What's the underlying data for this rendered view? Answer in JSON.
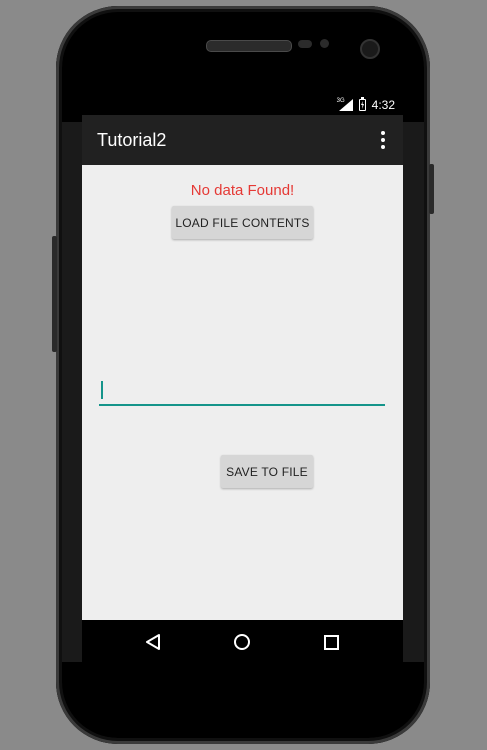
{
  "status_bar": {
    "network": "3G",
    "time": "4:32"
  },
  "app_bar": {
    "title": "Tutorial2",
    "menu_icon": "overflow-menu-icon"
  },
  "content": {
    "message": "No data Found!",
    "message_color": "#e53935",
    "load_button_label": "LOAD FILE CONTENTS",
    "input_value": "",
    "save_button_label": "SAVE TO FILE",
    "accent_color": "#14948a"
  },
  "nav_bar": {
    "back_icon": "back-icon",
    "home_icon": "home-icon",
    "recents_icon": "recents-icon"
  }
}
